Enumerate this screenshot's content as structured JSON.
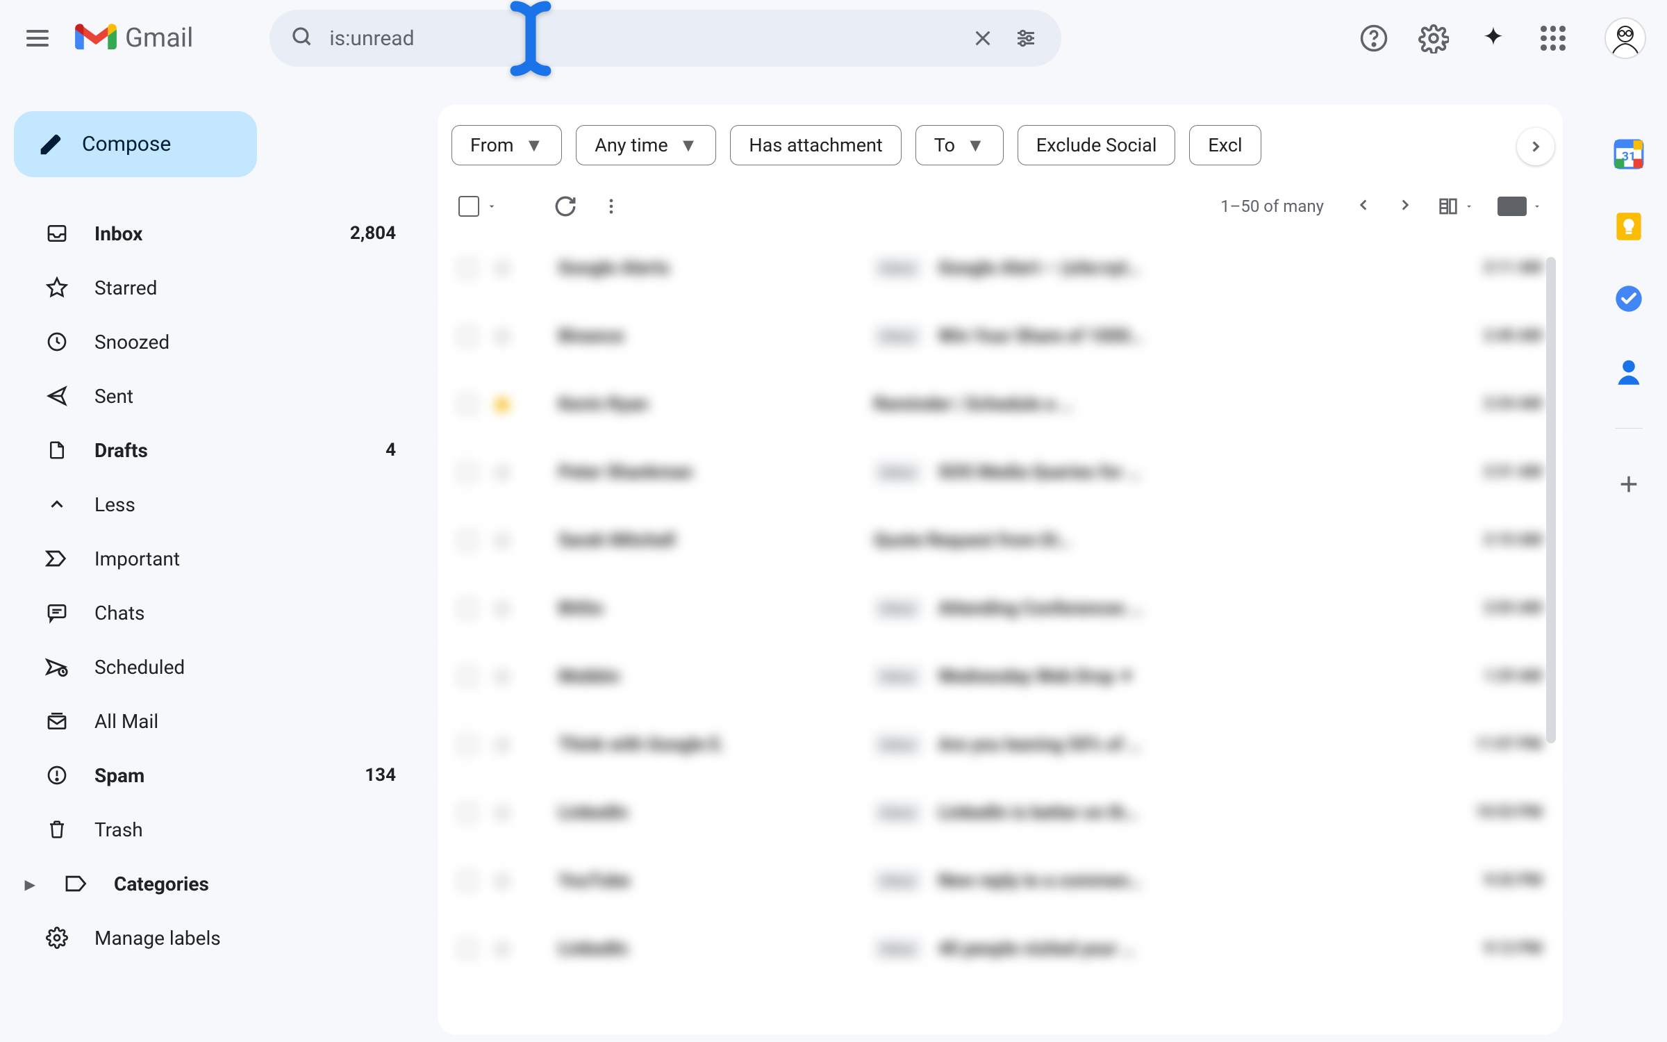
{
  "header": {
    "product_name": "Gmail",
    "search_value": "is:unread"
  },
  "compose_label": "Compose",
  "nav": [
    {
      "id": "inbox",
      "label": "Inbox",
      "count": "2,804",
      "bold": true,
      "icon": "inbox"
    },
    {
      "id": "starred",
      "label": "Starred",
      "count": "",
      "bold": false,
      "icon": "star"
    },
    {
      "id": "snoozed",
      "label": "Snoozed",
      "count": "",
      "bold": false,
      "icon": "clock"
    },
    {
      "id": "sent",
      "label": "Sent",
      "count": "",
      "bold": false,
      "icon": "send"
    },
    {
      "id": "drafts",
      "label": "Drafts",
      "count": "4",
      "bold": true,
      "icon": "draft"
    },
    {
      "id": "less",
      "label": "Less",
      "count": "",
      "bold": false,
      "icon": "less"
    },
    {
      "id": "important",
      "label": "Important",
      "count": "",
      "bold": false,
      "icon": "important"
    },
    {
      "id": "chats",
      "label": "Chats",
      "count": "",
      "bold": false,
      "icon": "chat"
    },
    {
      "id": "scheduled",
      "label": "Scheduled",
      "count": "",
      "bold": false,
      "icon": "schedule"
    },
    {
      "id": "allmail",
      "label": "All Mail",
      "count": "",
      "bold": false,
      "icon": "allmail"
    },
    {
      "id": "spam",
      "label": "Spam",
      "count": "134",
      "bold": true,
      "icon": "spam"
    },
    {
      "id": "trash",
      "label": "Trash",
      "count": "",
      "bold": false,
      "icon": "trash"
    },
    {
      "id": "categories",
      "label": "Categories",
      "count": "",
      "bold": true,
      "icon": "label",
      "has_arrow": true
    },
    {
      "id": "manage",
      "label": "Manage labels",
      "count": "",
      "bold": false,
      "icon": "gear"
    }
  ],
  "filters": {
    "from": "From",
    "anytime": "Any time",
    "attachment": "Has attachment",
    "to": "To",
    "exclude_social": "Exclude Social",
    "exclude_pr": "Excl"
  },
  "toolbar": {
    "page_info": "1–50 of many"
  },
  "mails": [
    {
      "sender": "Google Alerts",
      "tag": "Inbox",
      "subject": "Google Alert – (site:nyt…",
      "time": "2:11 AM",
      "star": false
    },
    {
      "sender": "Binance",
      "tag": "Inbox",
      "subject": "Win Your Share of 1000…",
      "time": "2:40 AM",
      "star": false
    },
    {
      "sender": "Kevin Ryan",
      "tag": "",
      "subject": "Reminder | Schedule a …",
      "time": "2:34 AM",
      "star": true
    },
    {
      "sender": "Peter Shankman",
      "tag": "Inbox",
      "subject": "SOS Media Queries for …",
      "time": "2:31 AM",
      "star": false
    },
    {
      "sender": "Sarah Mitchell",
      "tag": "",
      "subject": "Quote Request from Di…",
      "time": "2:10 AM",
      "star": false
    },
    {
      "sender": "BitGo",
      "tag": "Inbox",
      "subject": "Attending Conferences …",
      "time": "2:03 AM",
      "star": false
    },
    {
      "sender": "Mobbin",
      "tag": "Inbox",
      "subject": "Wednesday Web Drop  ✦",
      "time": "1:29 AM",
      "star": false
    },
    {
      "sender": "Think with Google E.",
      "tag": "Inbox",
      "subject": "Are you leaving 50% of …",
      "time": "11:07 PM",
      "star": false
    },
    {
      "sender": "LinkedIn",
      "tag": "Inbox",
      "subject": "LinkedIn is better on th…",
      "time": "10:53 PM",
      "star": false
    },
    {
      "sender": "YouTube",
      "tag": "Inbox",
      "subject": "New reply to a commen…",
      "time": "9:32 PM",
      "star": false
    },
    {
      "sender": "LinkedIn",
      "tag": "Inbox",
      "subject": "40 people visited your …",
      "time": "9:12 PM",
      "star": false
    }
  ],
  "side_apps": [
    "calendar",
    "keep",
    "tasks",
    "contacts"
  ]
}
